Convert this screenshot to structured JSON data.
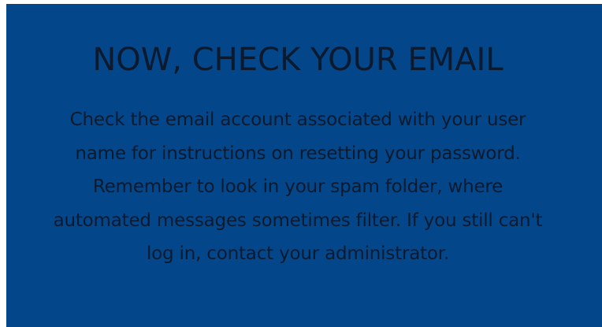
{
  "panel": {
    "title": "NOW, CHECK YOUR EMAIL",
    "message_lines": [
      "Check the email account associated with your user",
      "name for instructions on resetting your password.",
      "Remember to look in your spam folder, where",
      "automated messages sometimes filter. If you still can't",
      "log in, contact your administrator."
    ]
  },
  "colors": {
    "panel_background": "#03478a",
    "text": "#0b1a2e"
  }
}
